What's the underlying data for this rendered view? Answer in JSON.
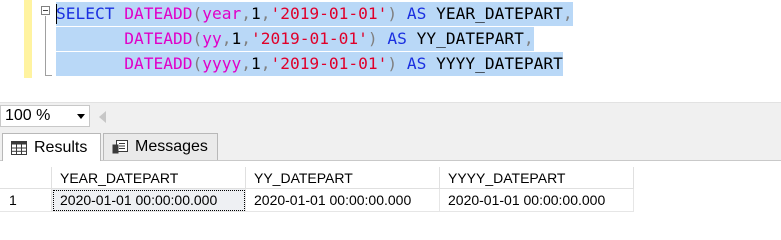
{
  "editor": {
    "lines": [
      [
        {
          "t": "SELECT",
          "c": "kw"
        },
        {
          "t": " ",
          "c": "txt"
        },
        {
          "t": "DATEADD",
          "c": "fn"
        },
        {
          "t": "(",
          "c": "op"
        },
        {
          "t": "year",
          "c": "fn"
        },
        {
          "t": ",",
          "c": "op"
        },
        {
          "t": "1",
          "c": "txt"
        },
        {
          "t": ",",
          "c": "op"
        },
        {
          "t": "'2019-01-01'",
          "c": "str"
        },
        {
          "t": ")",
          "c": "op"
        },
        {
          "t": " ",
          "c": "txt"
        },
        {
          "t": "AS",
          "c": "kw"
        },
        {
          "t": " YEAR_DATEPART",
          "c": "txt"
        },
        {
          "t": ",",
          "c": "op"
        }
      ],
      [
        {
          "t": "       ",
          "c": "txt"
        },
        {
          "t": "DATEADD",
          "c": "fn"
        },
        {
          "t": "(",
          "c": "op"
        },
        {
          "t": "yy",
          "c": "fn"
        },
        {
          "t": ",",
          "c": "op"
        },
        {
          "t": "1",
          "c": "txt"
        },
        {
          "t": ",",
          "c": "op"
        },
        {
          "t": "'2019-01-01'",
          "c": "str"
        },
        {
          "t": ")",
          "c": "op"
        },
        {
          "t": " ",
          "c": "txt"
        },
        {
          "t": "AS",
          "c": "kw"
        },
        {
          "t": " YY_DATEPART",
          "c": "txt"
        },
        {
          "t": ",",
          "c": "op"
        }
      ],
      [
        {
          "t": "       ",
          "c": "txt"
        },
        {
          "t": "DATEADD",
          "c": "fn"
        },
        {
          "t": "(",
          "c": "op"
        },
        {
          "t": "yyyy",
          "c": "fn"
        },
        {
          "t": ",",
          "c": "op"
        },
        {
          "t": "1",
          "c": "txt"
        },
        {
          "t": ",",
          "c": "op"
        },
        {
          "t": "'2019-01-01'",
          "c": "str"
        },
        {
          "t": ")",
          "c": "op"
        },
        {
          "t": " ",
          "c": "txt"
        },
        {
          "t": "AS",
          "c": "kw"
        },
        {
          "t": " YYYY_DATEPART",
          "c": "txt"
        }
      ]
    ],
    "colors": {
      "keyword": "#1a2fe0",
      "function": "#e000c8",
      "string": "#e0002a",
      "operator": "#808080",
      "selection": "#b9d8f7"
    }
  },
  "zoom": {
    "value": "100 %"
  },
  "tabs": {
    "results_label": "Results",
    "messages_label": "Messages"
  },
  "grid": {
    "columns": [
      "YEAR_DATEPART",
      "YY_DATEPART",
      "YYYY_DATEPART"
    ],
    "rows": [
      {
        "num": "1",
        "cells": [
          "2020-01-01 00:00:00.000",
          "2020-01-01 00:00:00.000",
          "2020-01-01 00:00:00.000"
        ]
      }
    ]
  }
}
